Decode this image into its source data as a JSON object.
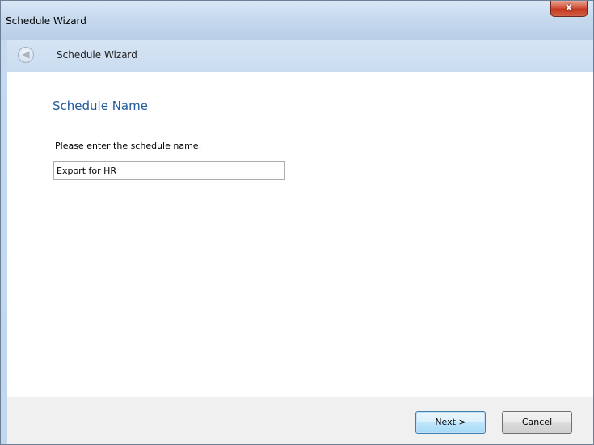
{
  "window": {
    "title": "Schedule Wizard",
    "close_glyph": "x"
  },
  "navbar": {
    "title": "Schedule Wizard",
    "back_icon": "back-arrow-icon"
  },
  "content": {
    "heading": "Schedule Name",
    "field_label": "Please enter the schedule name:",
    "schedule_name_value": "Export for HR"
  },
  "footer": {
    "next_label_accesskey": "N",
    "next_label_rest": "ext >",
    "cancel_label": "Cancel"
  },
  "colors": {
    "heading": "#1f5a9c",
    "close_button": "#c2391f",
    "default_button_border": "#3c7fb1"
  }
}
